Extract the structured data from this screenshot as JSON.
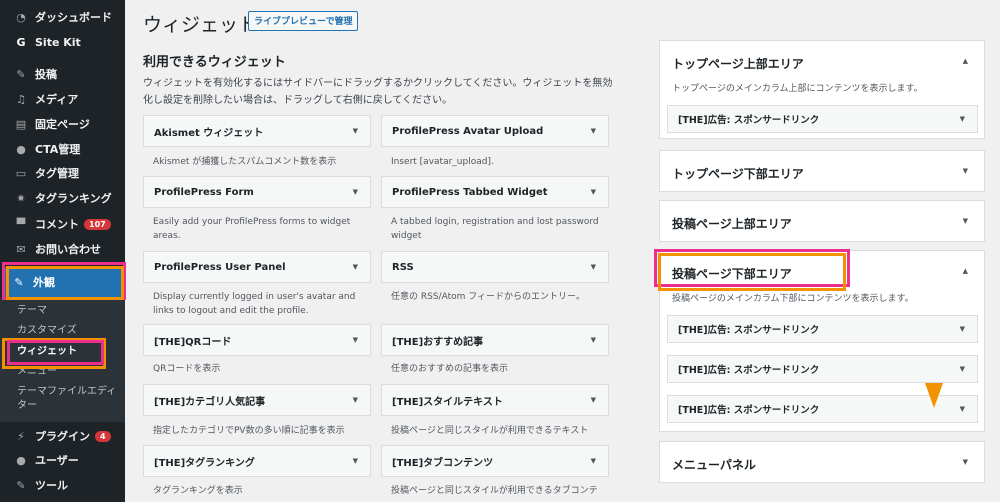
{
  "sidebar": {
    "items": [
      {
        "label": "ダッシュボード",
        "icon": "dashboard-icon",
        "glyph": "◔"
      },
      {
        "label": "Site Kit",
        "icon": "google-g-icon",
        "glyph": "G"
      },
      {
        "label": "投稿",
        "icon": "pushpin-icon",
        "glyph": "✎"
      },
      {
        "label": "メディア",
        "icon": "media-icon",
        "glyph": "♫"
      },
      {
        "label": "固定ページ",
        "icon": "page-icon",
        "glyph": "▤"
      },
      {
        "label": "CTA管理",
        "icon": "lightbulb-icon",
        "glyph": "●"
      },
      {
        "label": "タグ管理",
        "icon": "tag-icon",
        "glyph": "▭"
      },
      {
        "label": "タグランキング",
        "icon": "gear-icon",
        "glyph": "✷"
      },
      {
        "label": "コメント",
        "icon": "comment-icon",
        "glyph": "▀",
        "badge": "107"
      },
      {
        "label": "お問い合わせ",
        "icon": "mail-icon",
        "glyph": "✉"
      },
      {
        "label": "外観",
        "icon": "appearance-icon",
        "glyph": "✎"
      },
      {
        "label": "プラグイン",
        "icon": "plugin-icon",
        "glyph": "⚡",
        "badge": "4"
      },
      {
        "label": "ユーザー",
        "icon": "user-icon",
        "glyph": "●"
      },
      {
        "label": "ツール",
        "icon": "wrench-icon",
        "glyph": "✎"
      }
    ],
    "submenu": [
      "テーマ",
      "カスタマイズ",
      "ウィジェット",
      "メニュー",
      "テーマファイルエディター"
    ]
  },
  "header": {
    "title": "ウィジェット",
    "manage_button": "ライブプレビューで管理"
  },
  "available": {
    "title": "利用できるウィジェット",
    "description": "ウィジェットを有効化するにはサイドバーにドラッグするかクリックしてください。ウィジェットを無効化し設定を削除したい場合は、ドラッグして右側に戻してください。"
  },
  "widgets": [
    {
      "name": "Akismet ウィジェット",
      "desc": "Akismet が捕獲したスパムコメント数を表示"
    },
    {
      "name": "ProfilePress Avatar Upload",
      "desc": "Insert [avatar_upload]."
    },
    {
      "name": "ProfilePress Form",
      "desc": "Easily add your ProfilePress forms to widget areas."
    },
    {
      "name": "ProfilePress Tabbed Widget",
      "desc": "A tabbed login, registration and lost password widget"
    },
    {
      "name": "ProfilePress User Panel",
      "desc": "Display currently logged in user's avatar and links to logout and edit the profile."
    },
    {
      "name": "RSS",
      "desc": "任意の RSS/Atom フィードからのエントリー。"
    },
    {
      "name": "[THE]QRコード",
      "desc": "QRコードを表示"
    },
    {
      "name": "[THE]おすすめ記事",
      "desc": "任意のおすすめの記事を表示"
    },
    {
      "name": "[THE]カテゴリ人気記事",
      "desc": "指定したカテゴリでPV数の多い順に記事を表示"
    },
    {
      "name": "[THE]スタイルテキスト",
      "desc": "投稿ページと同じスタイルが利用できるテキスト"
    },
    {
      "name": "[THE]タグランキング",
      "desc": "タグランキングを表示"
    },
    {
      "name": "[THE]タブコンテンツ",
      "desc": "投稿ページと同じスタイルが利用できるタブコンテ"
    }
  ],
  "areas": [
    {
      "title": "トップページ上部エリア",
      "desc": "トップページのメインカラム上部にコンテンツを表示します。",
      "widgets": [
        "[THE]広告: スポンサードリンク"
      ]
    },
    {
      "title": "トップページ下部エリア"
    },
    {
      "title": "投稿ページ上部エリア"
    },
    {
      "title": "投稿ページ下部エリア",
      "desc": "投稿ページのメインカラム下部にコンテンツを表示します。",
      "widgets": [
        "[THE]広告: スポンサードリンク",
        "[THE]広告: スポンサードリンク",
        "[THE]広告: スポンサードリンク"
      ]
    },
    {
      "title": "メニューパネル"
    }
  ],
  "colors": {
    "highlight_pink": "#ec2f8c",
    "highlight_orange": "#f39200",
    "accent": "#2271b1"
  }
}
